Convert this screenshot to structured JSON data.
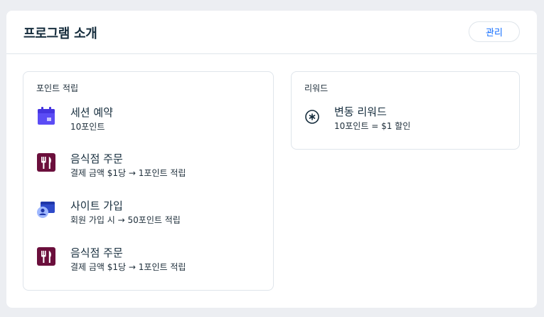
{
  "panel": {
    "title": "프로그램 소개",
    "manage_label": "관리"
  },
  "earn": {
    "title": "포인트 적립",
    "items": [
      {
        "icon": "calendar-icon",
        "title": "세션 예약",
        "subtitle": "10포인트"
      },
      {
        "icon": "restaurant-icon",
        "title": "음식점 주문",
        "subtitle": "결제 금액 $1당 → 1포인트 적립"
      },
      {
        "icon": "member-signup-icon",
        "title": "사이트 가입",
        "subtitle": "회원 가입 시 → 50포인트 적립"
      },
      {
        "icon": "restaurant-icon",
        "title": "음식점 주문",
        "subtitle": "결제 금액 $1당 → 1포인트 적립"
      }
    ]
  },
  "rewards": {
    "title": "리워드",
    "items": [
      {
        "icon": "reward-star-icon",
        "title": "변동 리워드",
        "subtitle": "10포인트 = $1 할인"
      }
    ]
  },
  "colors": {
    "accent": "#116dff",
    "calendar": "#5b4cf5",
    "restaurant": "#6b0f3c",
    "signup_blue": "#2e4ac9"
  }
}
